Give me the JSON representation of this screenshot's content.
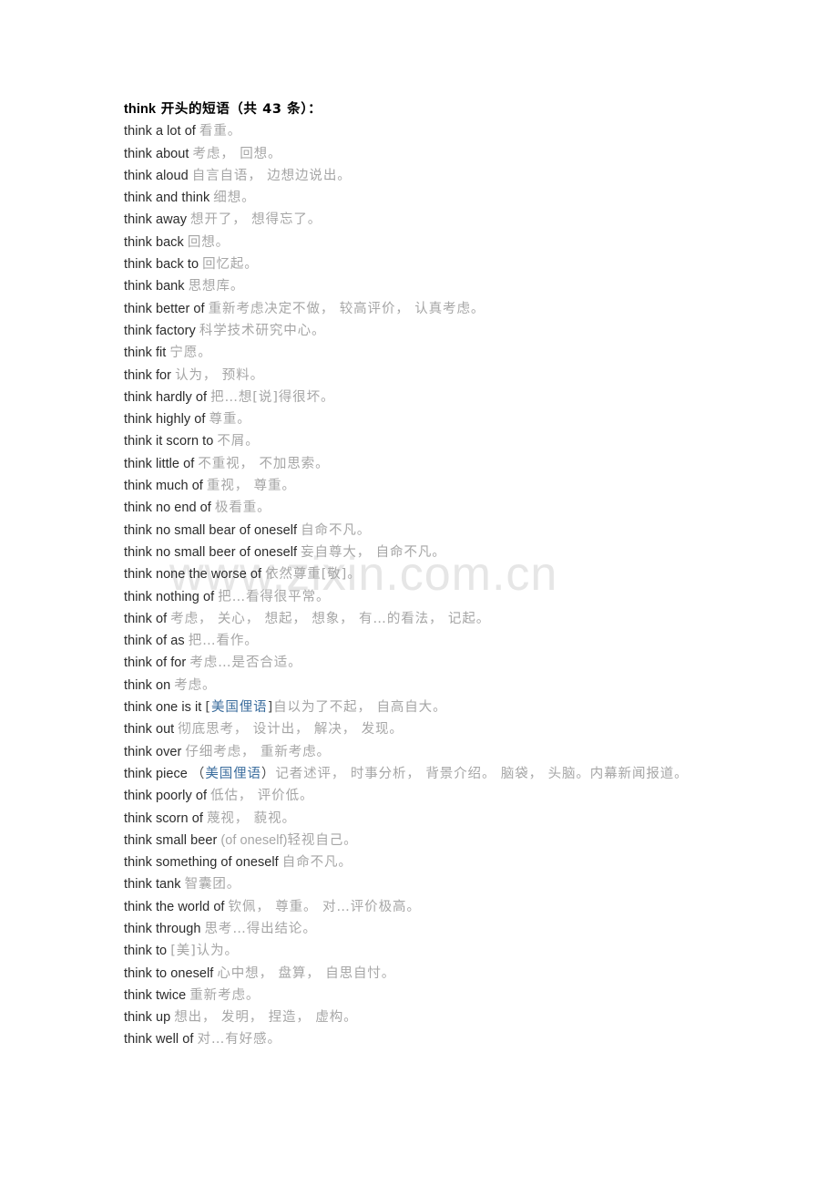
{
  "document": {
    "heading": {
      "term": "think",
      "text": " 开头的短语（共 43 条）："
    },
    "watermark": "www.zixin.com.cn",
    "colors": {
      "term": "#2b2b2b",
      "definition": "#a6a6a6",
      "tag_blue": "#3c6e9e",
      "heading": "#000000",
      "watermark": "#e6e6e6",
      "background": "#ffffff"
    },
    "entry_count": 43,
    "entries": [
      {
        "term": "think a lot of",
        "def": "看重。"
      },
      {
        "term": "think about",
        "def": "考虑， 回想。"
      },
      {
        "term": "think aloud",
        "def": "自言自语， 边想边说出。"
      },
      {
        "term": "think and think",
        "def": "细想。"
      },
      {
        "term": "think away",
        "def": "想开了， 想得忘了。"
      },
      {
        "term": "think back",
        "def": "回想。"
      },
      {
        "term": "think back to",
        "def": "回忆起。"
      },
      {
        "term": "think bank",
        "def": "思想库。"
      },
      {
        "term": "think better of",
        "def": "重新考虑决定不做， 较高评价， 认真考虑。"
      },
      {
        "term": "think factory",
        "def": "科学技术研究中心。"
      },
      {
        "term": "think fit",
        "def": "宁愿。"
      },
      {
        "term": "think for",
        "def": "认为， 预料。"
      },
      {
        "term": "think hardly of",
        "def": "把…想[说]得很坏。"
      },
      {
        "term": "think highly of",
        "def": "尊重。"
      },
      {
        "term": "think it scorn to",
        "def": "不屑。"
      },
      {
        "term": "think little of",
        "def": "不重视， 不加思索。"
      },
      {
        "term": "think much of",
        "def": "重视， 尊重。"
      },
      {
        "term": "think no end of",
        "def": "极看重。"
      },
      {
        "term": "think no small bear of oneself",
        "def": "自命不凡。"
      },
      {
        "term": "think no small beer of oneself",
        "def": "妄自尊大， 自命不凡。"
      },
      {
        "term": "think none the worse of",
        "def": "依然尊重[敬]。"
      },
      {
        "term": "think nothing of",
        "def": "把…看得很平常。"
      },
      {
        "term": "think of",
        "def": "考虑， 关心， 想起， 想象， 有…的看法， 记起。"
      },
      {
        "term": "think of as",
        "def": "把…看作。"
      },
      {
        "term": "think of for",
        "def": "考虑…是否合适。"
      },
      {
        "term": "think on",
        "def": "考虑。"
      },
      {
        "term": "think one is it",
        "def": "自以为了不起， 自高自大。",
        "tag": "[美国俚语]",
        "tag_open": "[",
        "tag_text": "美国俚语",
        "tag_close": "]"
      },
      {
        "term": "think out",
        "def": "彻底思考， 设计出， 解决， 发现。"
      },
      {
        "term": "think over",
        "def": "仔细考虑， 重新考虑。"
      },
      {
        "term": "think piece",
        "def": "记者述评， 时事分析， 背景介绍。 脑袋， 头脑。内幕新闻报道。",
        "tag_open": "（",
        "tag_text": "美国俚语",
        "tag_close": "）"
      },
      {
        "term": "think poorly of",
        "def": "低估， 评价低。"
      },
      {
        "term": "think scorn of",
        "def": "蔑视， 藐视。"
      },
      {
        "term": "think small beer",
        "def": "轻视自己。",
        "en_gray": "(of oneself)"
      },
      {
        "term": "think something of oneself",
        "def": "自命不凡。"
      },
      {
        "term": "think tank",
        "def": "智囊团。"
      },
      {
        "term": "think the world of",
        "def": "钦佩， 尊重。 对…评价极高。"
      },
      {
        "term": "think through",
        "def": "思考…得出结论。"
      },
      {
        "term": "think to",
        "def": "[美]认为。"
      },
      {
        "term": "think to oneself",
        "def": "心中想， 盘算， 自思自忖。"
      },
      {
        "term": "think twice",
        "def": "重新考虑。"
      },
      {
        "term": "think up",
        "def": "想出， 发明， 捏造， 虚构。"
      },
      {
        "term": "think well of",
        "def": "对…有好感。"
      }
    ]
  }
}
